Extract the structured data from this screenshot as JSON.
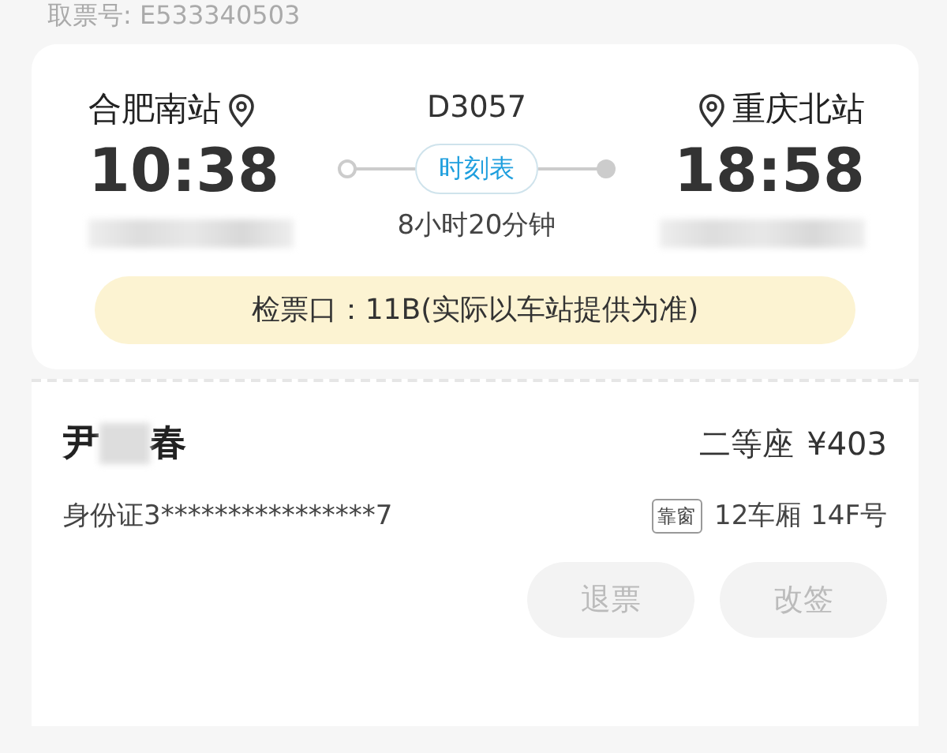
{
  "ticket_number": "取票号: E533340503",
  "trip": {
    "from_station": "合肥南站",
    "to_station": "重庆北站",
    "train": "D3057",
    "depart_time": "10:38",
    "arrive_time": "18:58",
    "timetable_button": "时刻表",
    "duration": "8小时20分钟"
  },
  "check_in": "检票口：11B(实际以车站提供为准)",
  "passenger": {
    "name_start": "尹",
    "name_end": "春",
    "seat_class": "二等座",
    "price": "¥403",
    "id_number": "身份证3****************7",
    "seat_tag": "靠窗",
    "seat": "12车厢 14F号"
  },
  "buttons": [
    {
      "label": "退票",
      "disabled": true
    },
    {
      "label": "改签",
      "disabled": true
    }
  ]
}
